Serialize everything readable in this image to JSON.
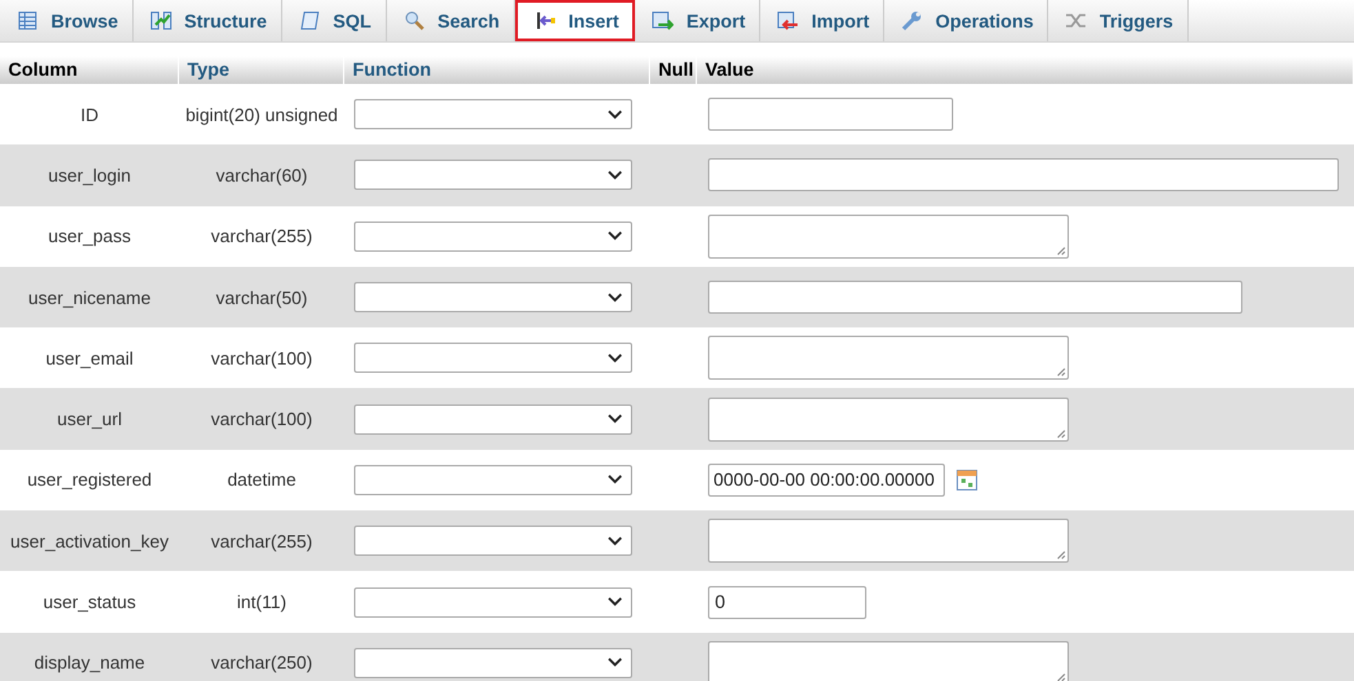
{
  "tabs": [
    {
      "label": "Browse",
      "selected": false
    },
    {
      "label": "Structure",
      "selected": false
    },
    {
      "label": "SQL",
      "selected": false
    },
    {
      "label": "Search",
      "selected": false
    },
    {
      "label": "Insert",
      "selected": true
    },
    {
      "label": "Export",
      "selected": false
    },
    {
      "label": "Import",
      "selected": false
    },
    {
      "label": "Operations",
      "selected": false
    },
    {
      "label": "Triggers",
      "selected": false
    }
  ],
  "table": {
    "columns": [
      "Column",
      "Type",
      "Function",
      "Null",
      "Value"
    ],
    "rows": [
      {
        "column": "ID",
        "type": "bigint(20) unsigned",
        "kind": "medium"
      },
      {
        "column": "user_login",
        "type": "varchar(60)",
        "kind": "wide"
      },
      {
        "column": "user_pass",
        "type": "varchar(255)",
        "kind": "textarea"
      },
      {
        "column": "user_nicename",
        "type": "varchar(50)",
        "kind": "long"
      },
      {
        "column": "user_email",
        "type": "varchar(100)",
        "kind": "textarea"
      },
      {
        "column": "user_url",
        "type": "varchar(100)",
        "kind": "textarea"
      },
      {
        "column": "user_registered",
        "type": "datetime",
        "kind": "date",
        "value": "0000-00-00 00:00:00.00000"
      },
      {
        "column": "user_activation_key",
        "type": "varchar(255)",
        "kind": "textarea"
      },
      {
        "column": "user_status",
        "type": "int(11)",
        "kind": "short",
        "value": "0"
      },
      {
        "column": "display_name",
        "type": "varchar(250)",
        "kind": "textarea"
      }
    ]
  }
}
